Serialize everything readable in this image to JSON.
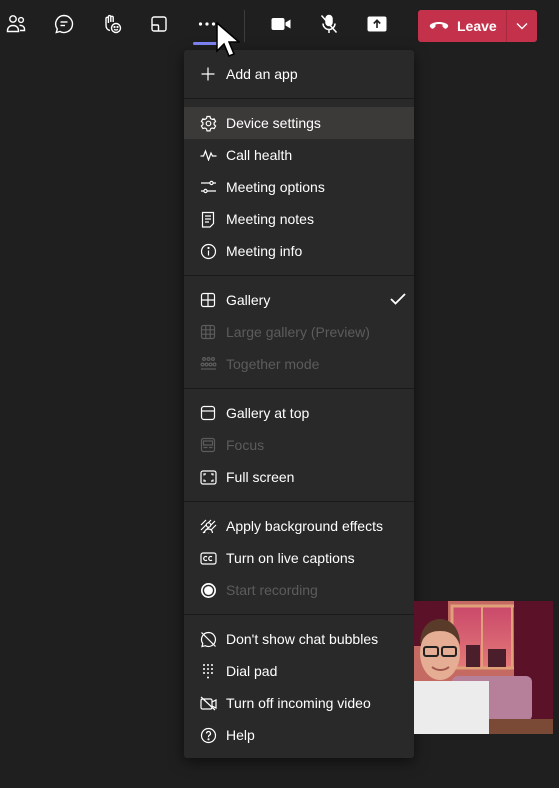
{
  "toolbar": {
    "buttons": [
      {
        "name": "people",
        "icon": "people-icon"
      },
      {
        "name": "chat",
        "icon": "chat-icon"
      },
      {
        "name": "reactions",
        "icon": "raise-hand-icon"
      },
      {
        "name": "rooms",
        "icon": "breakout-rooms-icon"
      },
      {
        "name": "more-actions",
        "icon": "more-icon",
        "active": true
      },
      {
        "name": "camera",
        "icon": "camera-icon"
      },
      {
        "name": "mic",
        "icon": "mic-off-icon"
      },
      {
        "name": "share",
        "icon": "share-icon"
      }
    ],
    "leave_label": "Leave",
    "leave_color": "#c4314b",
    "active_accent": "#7f85f5"
  },
  "menu": {
    "groups": [
      {
        "items": [
          {
            "label": "Add an app",
            "icon": "plus-icon",
            "enabled": true
          }
        ]
      },
      {
        "items": [
          {
            "label": "Device settings",
            "icon": "gear-icon",
            "enabled": true,
            "highlighted": true
          },
          {
            "label": "Call health",
            "icon": "pulse-icon",
            "enabled": true
          },
          {
            "label": "Meeting options",
            "icon": "sliders-icon",
            "enabled": true
          },
          {
            "label": "Meeting notes",
            "icon": "notes-icon",
            "enabled": true
          },
          {
            "label": "Meeting info",
            "icon": "info-icon",
            "enabled": true
          }
        ]
      },
      {
        "items": [
          {
            "label": "Gallery",
            "icon": "gallery-icon",
            "enabled": true,
            "checked": true
          },
          {
            "label": "Large gallery (Preview)",
            "icon": "large-gallery-icon",
            "enabled": false
          },
          {
            "label": "Together mode",
            "icon": "together-mode-icon",
            "enabled": false
          }
        ]
      },
      {
        "items": [
          {
            "label": "Gallery at top",
            "icon": "gallery-top-icon",
            "enabled": true
          },
          {
            "label": "Focus",
            "icon": "focus-icon",
            "enabled": false
          },
          {
            "label": "Full screen",
            "icon": "fullscreen-icon",
            "enabled": true
          }
        ]
      },
      {
        "items": [
          {
            "label": "Apply background effects",
            "icon": "background-effects-icon",
            "enabled": true
          },
          {
            "label": "Turn on live captions",
            "icon": "captions-icon",
            "enabled": true
          },
          {
            "label": "Start recording",
            "icon": "record-icon",
            "enabled": false
          }
        ]
      },
      {
        "items": [
          {
            "label": "Don't show chat bubbles",
            "icon": "chat-bubbles-off-icon",
            "enabled": true
          },
          {
            "label": "Dial pad",
            "icon": "dialpad-icon",
            "enabled": true
          },
          {
            "label": "Turn off incoming video",
            "icon": "video-off-icon",
            "enabled": true
          },
          {
            "label": "Help",
            "icon": "help-icon",
            "enabled": true
          }
        ]
      }
    ]
  },
  "self_video": {
    "label": "self-preview"
  }
}
